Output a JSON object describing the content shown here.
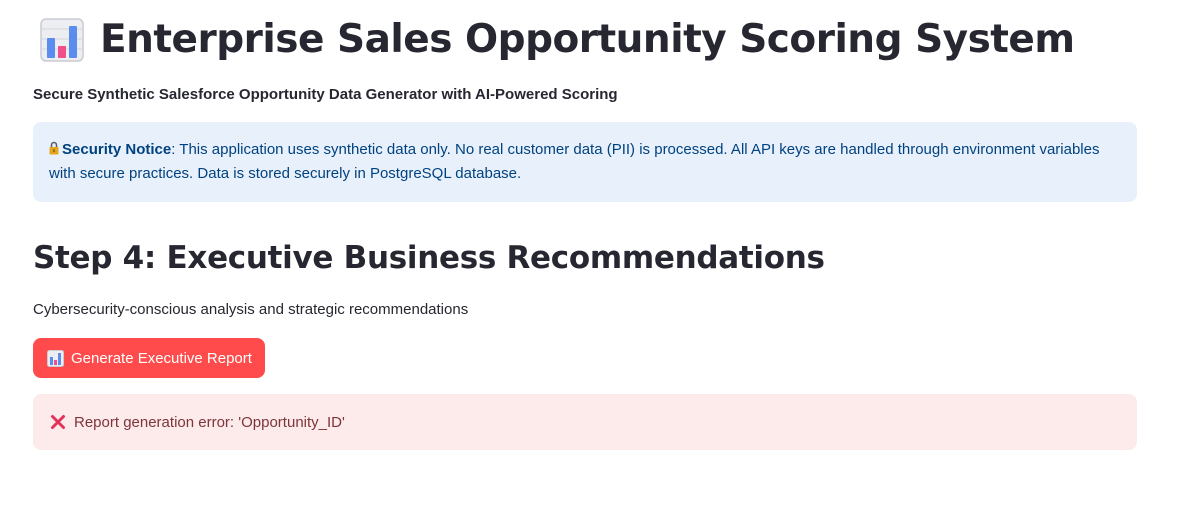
{
  "header": {
    "title_icon": "bar-chart-icon",
    "title": "Enterprise Sales Opportunity Scoring System",
    "subtitle": "Secure Synthetic Salesforce Opportunity Data Generator with AI-Powered Scoring"
  },
  "notice": {
    "icon": "lock-icon",
    "label": "Security Notice",
    "text": ": This application uses synthetic data only. No real customer data (PII) is processed. All API keys are handled through environment variables with secure practices. Data is stored securely in PostgreSQL database.",
    "bg_color": "#e8f0fb",
    "text_color": "#004280"
  },
  "section": {
    "heading": "Step 4: Executive Business Recommendations",
    "description": "Cybersecurity-conscious analysis and strategic recommendations"
  },
  "actions": {
    "report_button_icon": "bar-chart-icon",
    "report_button_label": "Generate Executive Report",
    "button_color": "#ff4b4b"
  },
  "error": {
    "icon": "cross-mark-icon",
    "message": "Report generation error: 'Opportunity_ID'",
    "bg_color": "#fdeaea",
    "text_color": "#7d353b"
  }
}
